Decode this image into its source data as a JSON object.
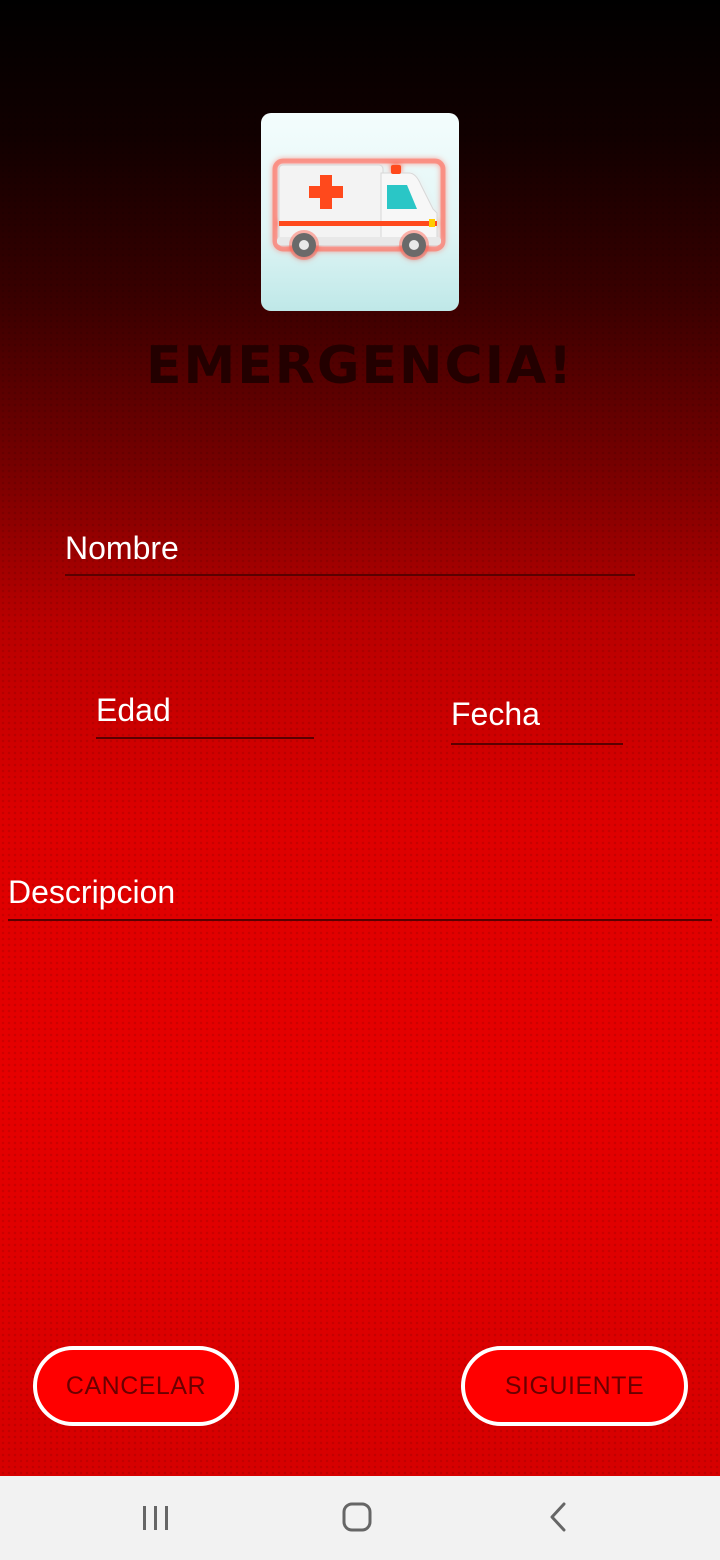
{
  "header": {
    "title": "EMERGENCIA!",
    "logo_icon": "ambulance-icon"
  },
  "form": {
    "nombre_placeholder": "Nombre",
    "edad_placeholder": "Edad",
    "fecha_placeholder": "Fecha",
    "descripcion_placeholder": "Descripcion"
  },
  "actions": {
    "cancel_label": "CANCELAR",
    "next_label": "SIGUIENTE"
  },
  "system_nav": {
    "recents_icon": "recents-icon",
    "home_icon": "home-icon",
    "back_icon": "back-icon"
  },
  "colors": {
    "button_fill": "#ff0000",
    "button_border": "#ffffff",
    "background_top": "#000000",
    "background_bottom": "#e60000"
  }
}
